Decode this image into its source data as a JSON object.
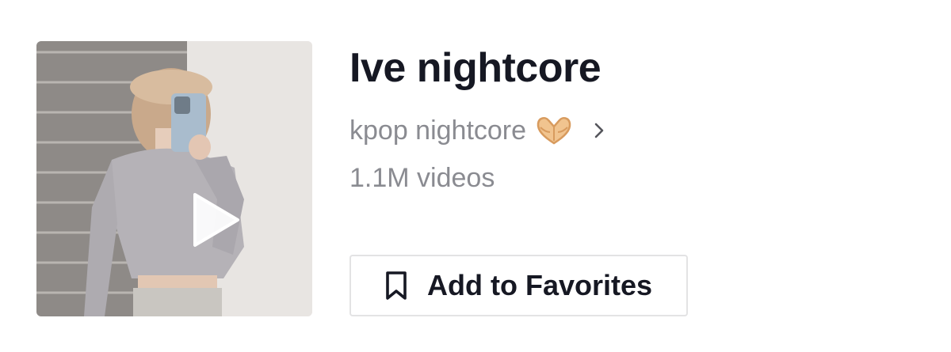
{
  "sound": {
    "title": "Ive nightcore",
    "creator": "kpop nightcore",
    "creator_icon": "heart-hands-emoji",
    "video_count": "1.1M videos"
  },
  "actions": {
    "favorites_label": "Add to Favorites",
    "favorites_icon": "bookmark-icon"
  },
  "cover": {
    "icon": "play-icon",
    "accent": "#ffffff"
  },
  "colors": {
    "title": "#161823",
    "secondary_text": "#8a8b91",
    "button_border": "#e3e3e4"
  }
}
